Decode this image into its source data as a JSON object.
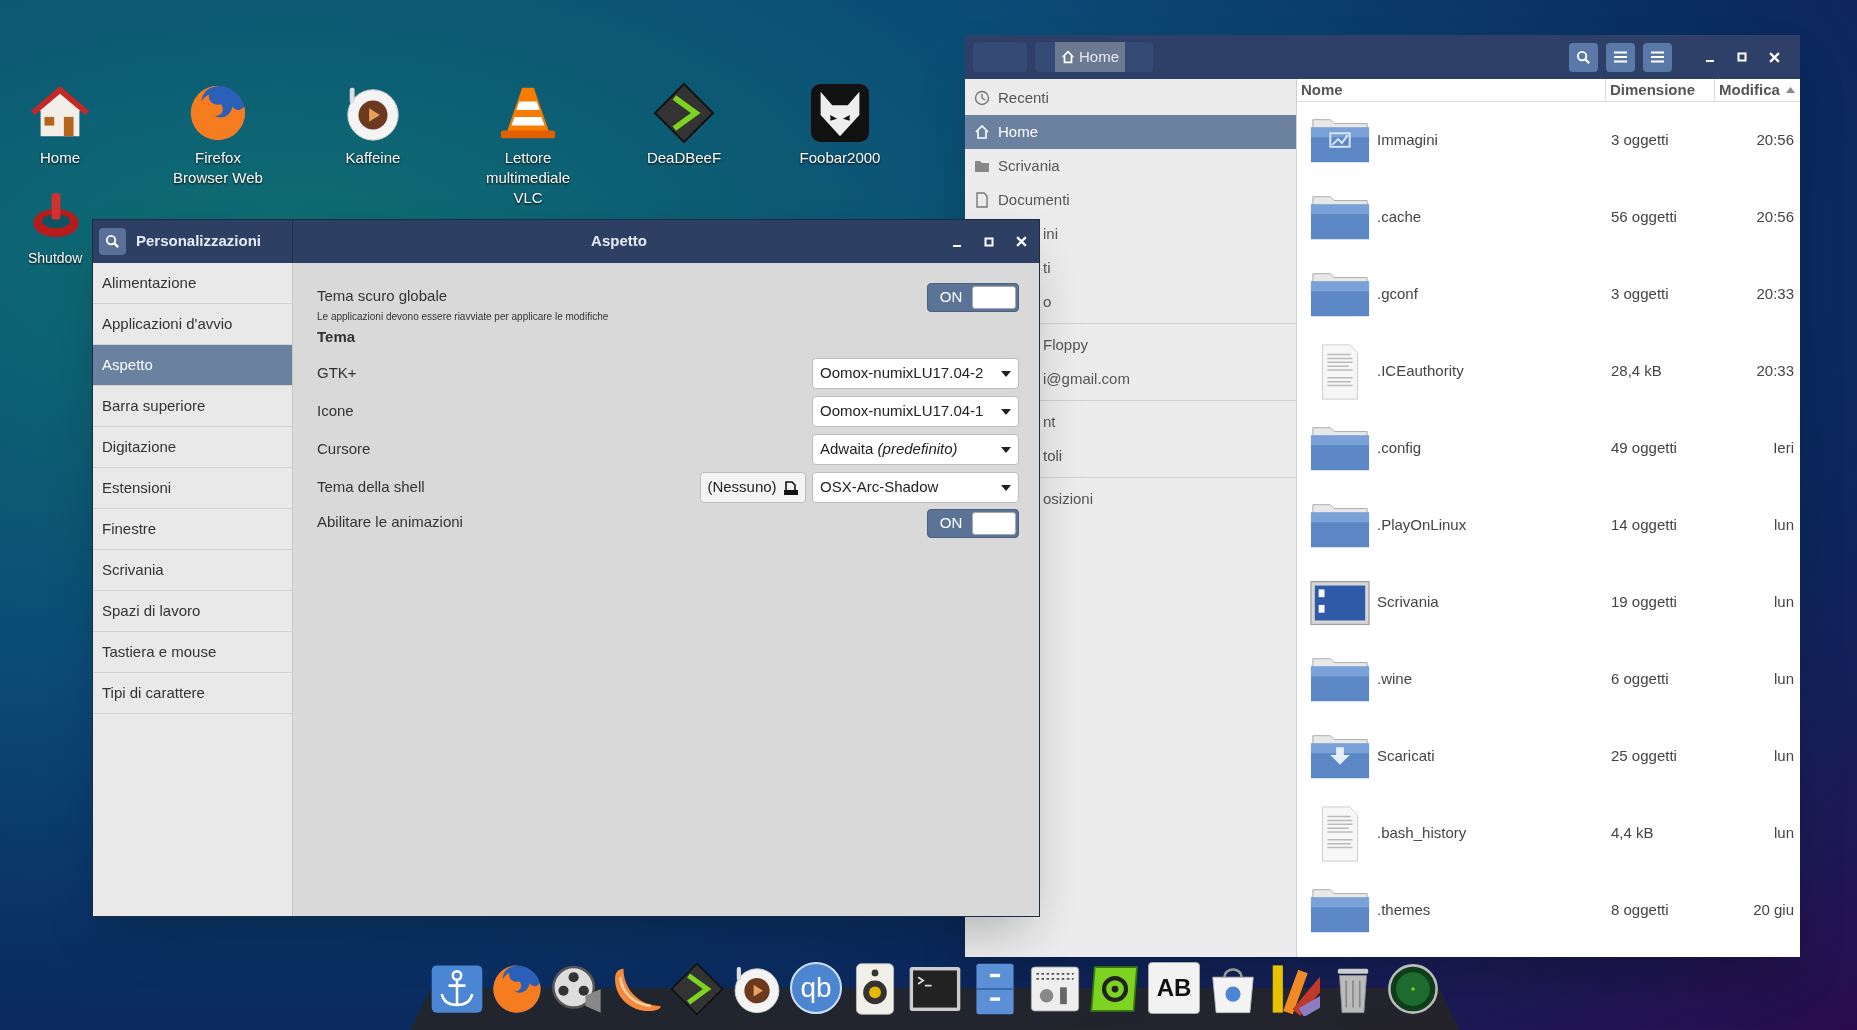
{
  "desktop_icons": [
    {
      "kind": "home",
      "label": "Home"
    },
    {
      "kind": "fox",
      "label": "Firefox Browser Web"
    },
    {
      "kind": "cup",
      "label": "Kaffeine"
    },
    {
      "kind": "cone",
      "label": "Lettore multimediale VLC"
    },
    {
      "kind": "diamond",
      "label": "DeaDBeeF"
    },
    {
      "kind": "foxhead",
      "label": "Foobar2000"
    },
    {
      "kind": "power",
      "label": "Shutdow"
    }
  ],
  "settings_window": {
    "app_title": "Personalizzazioni",
    "page_title": "Aspetto",
    "sidebar": [
      {
        "label": "Alimentazione",
        "selected": false
      },
      {
        "label": "Applicazioni d'avvio",
        "selected": false
      },
      {
        "label": "Aspetto",
        "selected": true
      },
      {
        "label": "Barra superiore",
        "selected": false
      },
      {
        "label": "Digitazione",
        "selected": false
      },
      {
        "label": "Estensioni",
        "selected": false
      },
      {
        "label": "Finestre",
        "selected": false
      },
      {
        "label": "Scrivania",
        "selected": false
      },
      {
        "label": "Spazi di lavoro",
        "selected": false
      },
      {
        "label": "Tastiera e mouse",
        "selected": false
      },
      {
        "label": "Tipi di carattere",
        "selected": false
      }
    ],
    "rows": [
      {
        "kind": "switch",
        "label": "Tema scuro globale",
        "note": "Le applicazioni devono essere riavviate per applicare le modifiche",
        "on": true,
        "state_text": "ON"
      },
      {
        "kind": "heading",
        "label": "Tema"
      },
      {
        "kind": "combo",
        "label": "GTK+",
        "value": "Oomox-numixLU17.04-2"
      },
      {
        "kind": "combo",
        "label": "Icone",
        "value": "Oomox-numixLU17.04-1"
      },
      {
        "kind": "combo",
        "label": "Cursore",
        "value": "Adwaita *(predefinito)*"
      },
      {
        "kind": "combo",
        "label": "Tema della shell",
        "value": "OSX-Arc-Shadow",
        "extra_button": "(Nessuno)"
      },
      {
        "kind": "switch",
        "label": "Abilitare le animazioni",
        "on": true,
        "state_text": "ON"
      }
    ]
  },
  "file_manager": {
    "path_button": {
      "label": "Home",
      "selected": true
    },
    "places": [
      {
        "items": [
          {
            "kind": "clock",
            "label": "Recenti",
            "selected": false
          },
          {
            "kind": "home",
            "label": "Home",
            "selected": true
          },
          {
            "kind": "folder",
            "label": "Scrivania",
            "selected": false
          },
          {
            "kind": "document",
            "label": "Documenti",
            "selected": false
          },
          {
            "kind": "partial",
            "label": "ini",
            "selected": false
          },
          {
            "kind": "partial",
            "label": "ti",
            "selected": false
          },
          {
            "kind": "partial",
            "label": "o",
            "selected": false
          }
        ]
      },
      {
        "items": [
          {
            "kind": "partial",
            "label": "Floppy",
            "selected": false
          },
          {
            "kind": "partial",
            "label": "i@gmail.com",
            "selected": false
          }
        ]
      },
      {
        "items": [
          {
            "kind": "partial",
            "label": "nt",
            "selected": false
          },
          {
            "kind": "partial",
            "label": "toli",
            "selected": false
          }
        ]
      },
      {
        "items": [
          {
            "kind": "partial",
            "label": "osizioni",
            "selected": false
          }
        ]
      }
    ],
    "columns": [
      {
        "label": "Nome",
        "sorted": false
      },
      {
        "label": "Dimensione",
        "sorted": false
      },
      {
        "label": "Modifica",
        "sorted": true
      }
    ],
    "rows": [
      {
        "kind": "pictures",
        "name": "Immagini",
        "size": "3 oggetti",
        "modified": "20:56"
      },
      {
        "kind": "folder",
        "name": ".cache",
        "size": "56 oggetti",
        "modified": "20:56"
      },
      {
        "kind": "folder",
        "name": ".gconf",
        "size": "3 oggetti",
        "modified": "20:33"
      },
      {
        "kind": "text",
        "name": ".ICEauthority",
        "size": "28,4 kB",
        "modified": "20:33"
      },
      {
        "kind": "folder",
        "name": ".config",
        "size": "49 oggetti",
        "modified": "Ieri"
      },
      {
        "kind": "folder",
        "name": ".PlayOnLinux",
        "size": "14 oggetti",
        "modified": "lun"
      },
      {
        "kind": "desktop",
        "name": "Scrivania",
        "size": "19 oggetti",
        "modified": "lun"
      },
      {
        "kind": "folder",
        "name": ".wine",
        "size": "6 oggetti",
        "modified": "lun"
      },
      {
        "kind": "download",
        "name": "Scaricati",
        "size": "25 oggetti",
        "modified": "lun"
      },
      {
        "kind": "text",
        "name": ".bash_history",
        "size": "4,4 kB",
        "modified": "lun"
      },
      {
        "kind": "folder",
        "name": ".themes",
        "size": "8 oggetti",
        "modified": "20 giu"
      }
    ]
  },
  "dock": [
    {
      "kind": "anchor"
    },
    {
      "kind": "fox"
    },
    {
      "kind": "reel"
    },
    {
      "kind": "slice"
    },
    {
      "kind": "diamond"
    },
    {
      "kind": "cup"
    },
    {
      "kind": "letters",
      "text": "qb"
    },
    {
      "kind": "speaker"
    },
    {
      "kind": "terminal"
    },
    {
      "kind": "cabinet"
    },
    {
      "kind": "mixer"
    },
    {
      "kind": "gearbox"
    },
    {
      "kind": "letters-card",
      "text": "AB"
    },
    {
      "kind": "bag"
    },
    {
      "kind": "swatch"
    },
    {
      "kind": "trash"
    },
    {
      "kind": "radar"
    }
  ]
}
